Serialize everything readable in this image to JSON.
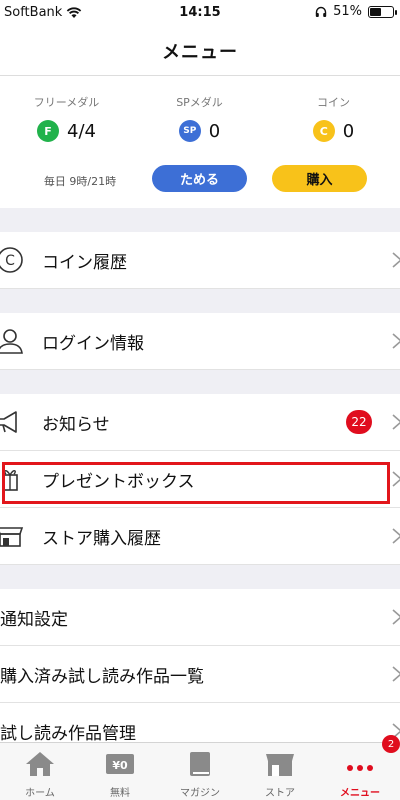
{
  "status_bar": {
    "carrier": "SoftBank",
    "time": "14:15",
    "battery": "51%",
    "battery_level": 0.51
  },
  "header": {
    "title": "メニュー"
  },
  "wallet": {
    "free_medal": {
      "label": "フリーメダル",
      "badge": "F",
      "value": "4/4",
      "color": "#21b24b"
    },
    "sp_medal": {
      "label": "SPメダル",
      "badge": "SP",
      "value": "0",
      "color": "#3d6fd6"
    },
    "coin": {
      "label": "コイン",
      "badge": "C",
      "value": "0",
      "color": "#f8c21a"
    },
    "schedule": "毎日 9時/21時",
    "save_label": "ためる",
    "buy_label": "購入"
  },
  "menu": {
    "coin_history": "コイン履歴",
    "login_info": "ログイン情報",
    "notices": "お知らせ",
    "notices_count": "22",
    "present_box": "プレゼントボックス",
    "store_history": "ストア購入履歴",
    "notification_settings": "通知設定",
    "purchased_trials": "購入済み試し読み作品一覧",
    "trial_management": "試し読み作品管理"
  },
  "tabs": [
    {
      "label": "ホーム",
      "icon": "home-icon"
    },
    {
      "label": "無料",
      "icon": "free-ticket-icon",
      "icon_text": "¥0"
    },
    {
      "label": "マガジン",
      "icon": "book-icon"
    },
    {
      "label": "ストア",
      "icon": "store-icon"
    },
    {
      "label": "メニュー",
      "icon": "more-dots-icon",
      "badge": "2"
    }
  ],
  "colors": {
    "accent_red": "#e00d1e",
    "accent_blue": "#3d6fd6",
    "accent_yellow": "#f8c21a"
  }
}
